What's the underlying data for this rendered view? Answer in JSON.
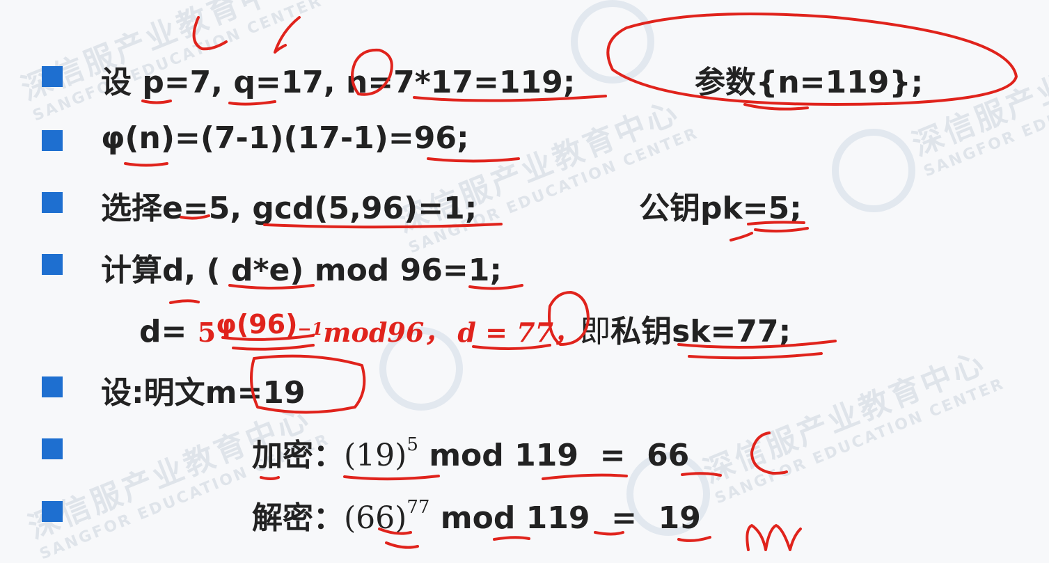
{
  "watermark": {
    "cn": "深信服产业教育中心",
    "en": "SANGFOR EDUCATION CENTER"
  },
  "lines": {
    "l1": {
      "text": "设 p=7, q=17, n=7*17=119;",
      "right": "参数{n=119};"
    },
    "l2": {
      "text": "φ(n)=(7-1)(17-1)=96;"
    },
    "l3": {
      "text": "选择e=5, gcd(5,96)=1;",
      "right": "公钥pk=5;"
    },
    "l4": {
      "text": "计算d, ( d*e) mod 96=1;"
    },
    "l5": {
      "prefix": "d= ",
      "formula_base": "5",
      "formula_phi": "φ(96)",
      "formula_exp": "−1",
      "formula_mod": "mod96，",
      "formula_d": "d = 77，",
      "suffix_a": "即",
      "suffix_b": "私钥sk=77;"
    },
    "l6": {
      "text": "设:明文m=19"
    },
    "l7": {
      "label": "加密：",
      "base": "(19)",
      "exp": "5",
      "rest": " mod 119  =  66"
    },
    "l8": {
      "label": "解密：",
      "base": "(66)",
      "exp": "77",
      "rest": " mod 119  =  19"
    }
  },
  "colors": {
    "bullet": "#1e6fd0",
    "ink": "#e0231c",
    "text": "#222222"
  },
  "annotations": {
    "handwritten": "red pen strokes over the slide"
  }
}
